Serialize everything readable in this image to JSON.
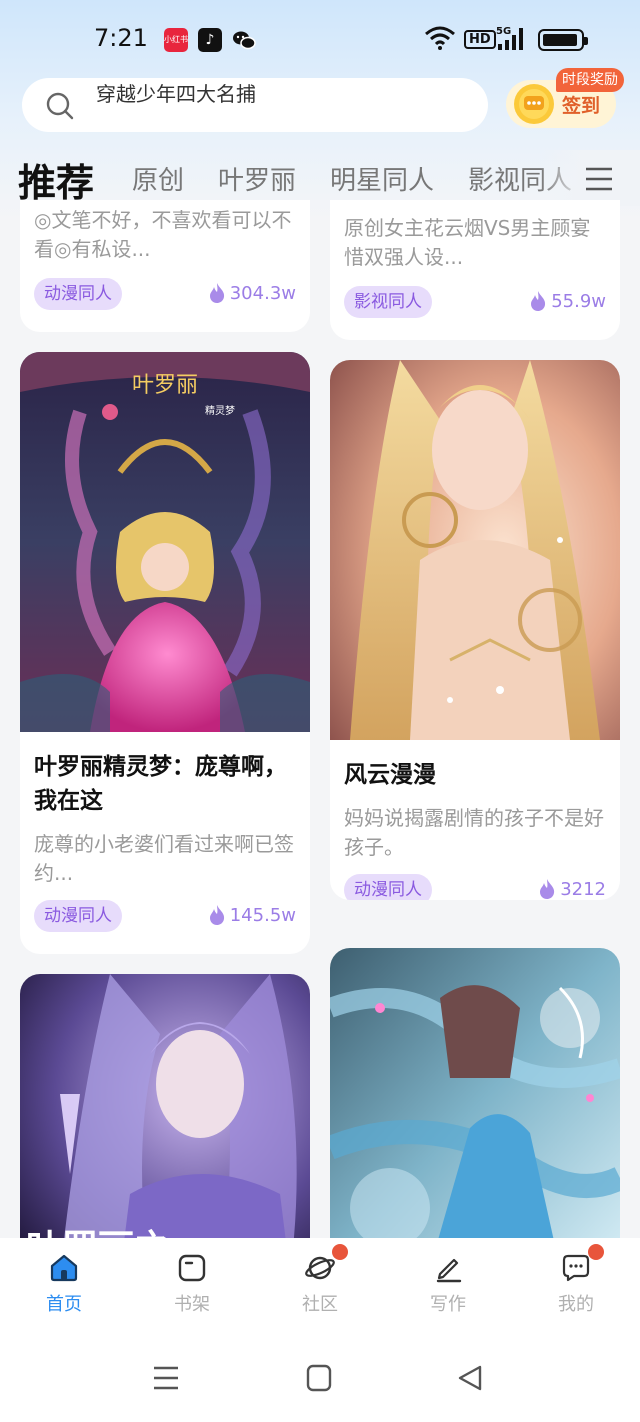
{
  "status_bar": {
    "time": "7:21",
    "apps": [
      "小红书",
      "抖音",
      "微信"
    ],
    "network": "5G",
    "hd": "HD"
  },
  "search": {
    "query": "穿越少年四大名捕",
    "icon": "search-icon"
  },
  "checkin": {
    "label": "签到",
    "badge": "时段奖励",
    "icon": "coin-chat-icon"
  },
  "tabs": {
    "items": [
      "推荐",
      "原创",
      "叶罗丽",
      "明星同人",
      "影视同人"
    ],
    "active_index": 0,
    "menu_icon": "hamburger-menu-icon"
  },
  "cards": [
    {
      "desc": "◎文笔不好，不喜欢看可以不看◎有私设...",
      "tag": "动漫同人",
      "heat": "304.3w"
    },
    {
      "desc": "原创女主花云烟VS男主顾宴惜双强人设...",
      "tag": "影视同人",
      "heat": "55.9w"
    },
    {
      "title": "叶罗丽精灵梦：庞尊啊，我在这",
      "desc": "庞尊的小老婆们看过来啊已签约...",
      "tag": "动漫同人",
      "heat": "145.5w",
      "cover_text": "叶罗丽",
      "cover_subtext": "精灵梦"
    },
    {
      "title": "风云漫漫",
      "desc": "妈妈说揭露剧情的孩子不是好孩子。",
      "tag": "动漫同人",
      "heat": "3212"
    },
    {
      "cover_text": "叶罗丽之"
    },
    {}
  ],
  "bottom_nav": {
    "items": [
      {
        "label": "首页",
        "icon": "home-icon",
        "active": true
      },
      {
        "label": "书架",
        "icon": "bookshelf-icon"
      },
      {
        "label": "社区",
        "icon": "planet-icon",
        "badge": true
      },
      {
        "label": "写作",
        "icon": "pen-icon"
      },
      {
        "label": "我的",
        "icon": "chat-bubble-icon",
        "badge": true
      }
    ]
  },
  "colors": {
    "accent": "#2d8df0",
    "tag_bg": "#e7dcfb",
    "tag_text": "#8a5ae0",
    "checkin_text": "#e0602a",
    "badge": "#e8553b"
  }
}
